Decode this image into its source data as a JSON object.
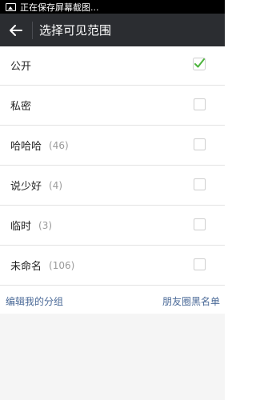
{
  "status_bar": {
    "text": "正在保存屏幕截图...",
    "icon": "image-icon"
  },
  "header": {
    "title": "选择可见范围",
    "back_icon": "arrow-left-icon"
  },
  "options": [
    {
      "label": "公开",
      "count": "",
      "checked": true
    },
    {
      "label": "私密",
      "count": "",
      "checked": false
    },
    {
      "label": "哈哈哈",
      "count": "(46)",
      "checked": false
    },
    {
      "label": "说少好",
      "count": "(4)",
      "checked": false
    },
    {
      "label": "临时",
      "count": "(3)",
      "checked": false
    },
    {
      "label": "未命名",
      "count": "(106)",
      "checked": false
    }
  ],
  "footer": {
    "edit_groups_label": "编辑我的分组",
    "blacklist_label": "朋友圈黑名单"
  },
  "colors": {
    "accent_check": "#4cb43c",
    "link": "#4b6a98",
    "toolbar": "#2b2d31"
  }
}
